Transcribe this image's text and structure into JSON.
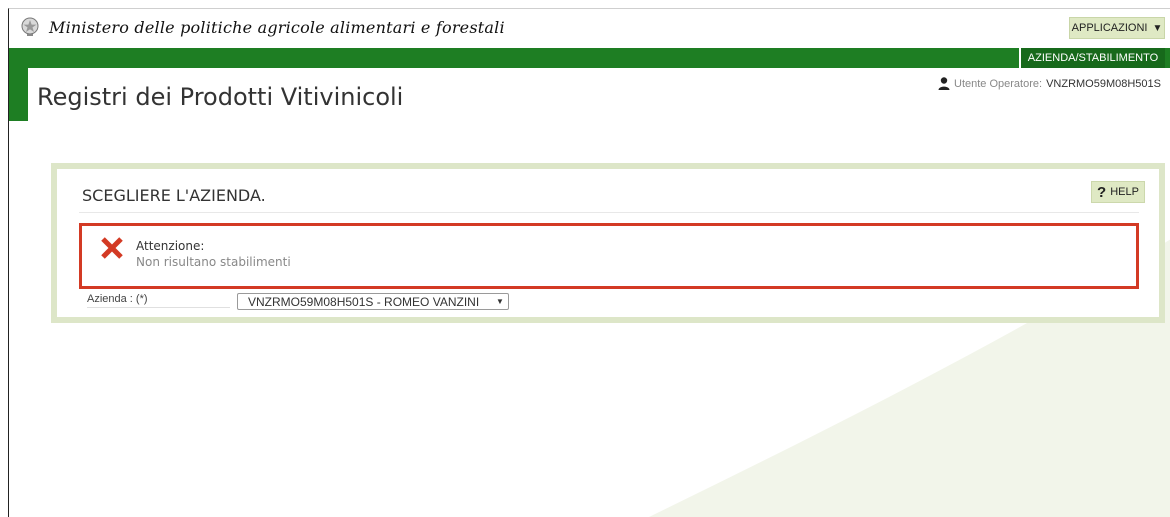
{
  "header": {
    "ministry_title": "Ministero delle politiche agricole alimentari e forestali",
    "applications_label": "APPLICAZIONI",
    "company_label": "AZIENDA/STABILIMENTO",
    "emblem_icon": "italian-republic-emblem-icon"
  },
  "page": {
    "title": "Registri dei Prodotti Vitivinicoli",
    "user_prefix": "Utente Operatore:",
    "user_code": "VNZRMO59M08H501S"
  },
  "panel": {
    "title": "SCEGLIERE L'AZIENDA.",
    "help_label": "HELP",
    "alert": {
      "title": "Attenzione:",
      "message": "Non risultano stabilimenti",
      "icon": "error-x-icon"
    },
    "field": {
      "label": "Azienda : (*)",
      "selected_value": "VNZRMO59M08H501S - ROMEO VANZINI"
    }
  },
  "colors": {
    "brand_green": "#1e7e23",
    "accent_light_green": "#dfe9c4",
    "panel_border": "#dde6c8",
    "alert_red": "#d33a24"
  }
}
